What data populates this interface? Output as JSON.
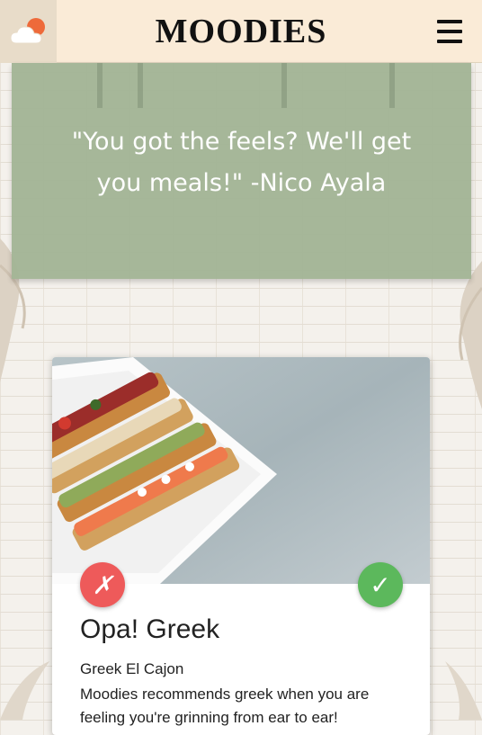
{
  "header": {
    "title": "MOODIES",
    "logo_icon": "sun-cloud-icon",
    "menu_icon": "hamburger-menu-icon"
  },
  "hero": {
    "quote": "\"You got the feels? We'll get you meals!\" -Nico Ayala"
  },
  "card": {
    "image_icon": "food-platter-image",
    "reject_label": "✗",
    "accept_label": "✓",
    "title": "Opa! Greek",
    "subtitle": "Greek El Cajon",
    "description": "Moodies recommends greek when you are feeling you're grinning from ear to ear!"
  },
  "colors": {
    "header_bg": "#faebd7",
    "hero_bg": "#a3b596",
    "reject": "#ee5a5a",
    "accept": "#5cb85c"
  }
}
